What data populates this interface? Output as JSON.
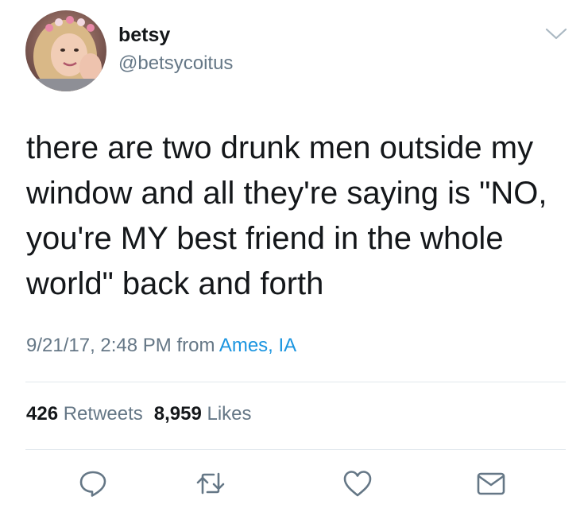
{
  "user": {
    "display_name": "betsy",
    "handle": "@betsycoitus"
  },
  "tweet": {
    "text": "there are two drunk men outside my window and all they're saying is \"NO, you're MY best friend in the whole world\" back and forth",
    "timestamp": "9/21/17, 2:48 PM",
    "from_label": "from",
    "location": "Ames, IA"
  },
  "stats": {
    "retweets_count": "426",
    "retweets_label": "Retweets",
    "likes_count": "8,959",
    "likes_label": "Likes"
  },
  "icons": {
    "menu": "chevron-down-icon",
    "reply": "reply-icon",
    "retweet": "retweet-icon",
    "like": "heart-icon",
    "message": "envelope-icon"
  },
  "colors": {
    "text": "#14171a",
    "secondary": "#657786",
    "link": "#1b95e0",
    "divider": "#e1e8ed",
    "icon": "#657786"
  }
}
